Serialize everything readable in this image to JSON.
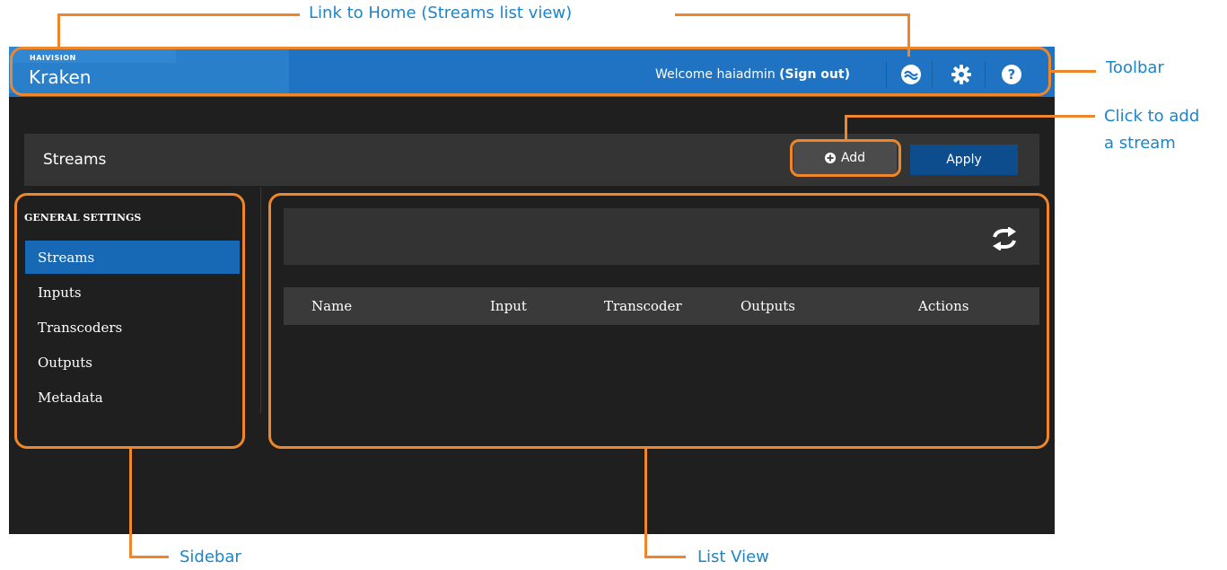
{
  "app": {
    "brand_small": "HAIVISION",
    "brand_name": "Kraken",
    "welcome_text": "Welcome haiadmin",
    "signout_label": "(Sign out)"
  },
  "toolbar": {
    "icons": [
      "kraken-home-icon",
      "gear-icon",
      "help-icon"
    ]
  },
  "page": {
    "title": "Streams",
    "add_label": "Add",
    "apply_label": "Apply"
  },
  "sidebar": {
    "heading": "GENERAL SETTINGS",
    "items": [
      {
        "label": "Streams",
        "active": true
      },
      {
        "label": "Inputs",
        "active": false
      },
      {
        "label": "Transcoders",
        "active": false
      },
      {
        "label": "Outputs",
        "active": false
      },
      {
        "label": "Metadata",
        "active": false
      }
    ]
  },
  "list": {
    "columns": [
      "Name",
      "Input",
      "Transcoder",
      "Outputs",
      "Actions"
    ],
    "rows": []
  },
  "annotations": {
    "home_link": "Link to Home (Streams list view)",
    "toolbar": "Toolbar",
    "add_stream_line1": "Click to add",
    "add_stream_line2": "a stream",
    "sidebar": "Sidebar",
    "list_view": "List View"
  },
  "colors": {
    "toolbar": "#1f73c2",
    "background": "#1f1f1f",
    "active_item": "#1768b5",
    "apply_button": "#0d4d8e",
    "annotation_orange": "#f0862a",
    "annotation_text": "#1e84c8"
  }
}
